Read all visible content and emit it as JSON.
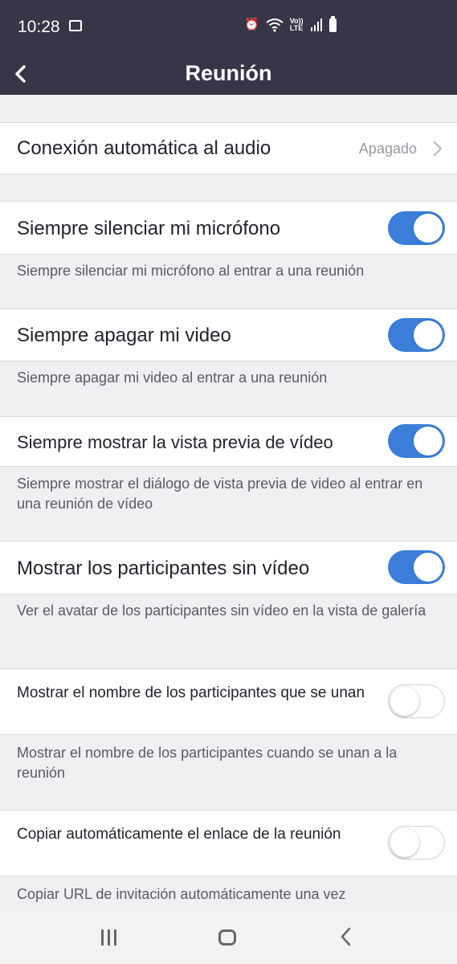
{
  "status_bar": {
    "time": "10:28",
    "icons": [
      "image-icon",
      "alarm-icon",
      "wifi-icon",
      "volte-icon",
      "signal-icon",
      "battery-icon"
    ],
    "volte_top": "Vo))",
    "volte_bottom": "LTE"
  },
  "app_bar": {
    "title": "Reunión",
    "back_icon": "chevron-left-icon"
  },
  "settings": {
    "audio": {
      "label": "Conexión automática al audio",
      "value": "Apagado"
    },
    "mute_mic": {
      "label": "Siempre silenciar mi micrófono",
      "enabled": true,
      "description": "Siempre silenciar mi micrófono al entrar a una reunión"
    },
    "video_off": {
      "label": "Siempre apagar mi video",
      "enabled": true,
      "description": "Siempre apagar mi video al entrar a una reunión"
    },
    "video_preview": {
      "label": "Siempre mostrar la vista previa de vídeo",
      "enabled": true,
      "description": "Siempre mostrar el diálogo de vista previa de video al entrar en una reunión de vídeo"
    },
    "show_no_video": {
      "label": "Mostrar los participantes sin vídeo",
      "enabled": true,
      "description": "Ver el avatar de los participantes sin vídeo en la vista de galería"
    },
    "show_join_names": {
      "label": "Mostrar el nombre de los participantes que se unan",
      "enabled": false,
      "description": "Mostrar el nombre de los participantes cuando se unan a la reunión"
    },
    "copy_link": {
      "label": "Copiar automáticamente el enlace de la reunión",
      "enabled": false,
      "description": "Copiar URL de invitación automáticamente una vez"
    }
  },
  "colors": {
    "header": "#363648",
    "toggle_on": "#3a7ed9",
    "background": "#f0f0f2"
  },
  "nav_bar": {
    "icons": [
      "recent-apps-icon",
      "home-icon",
      "back-icon"
    ]
  }
}
